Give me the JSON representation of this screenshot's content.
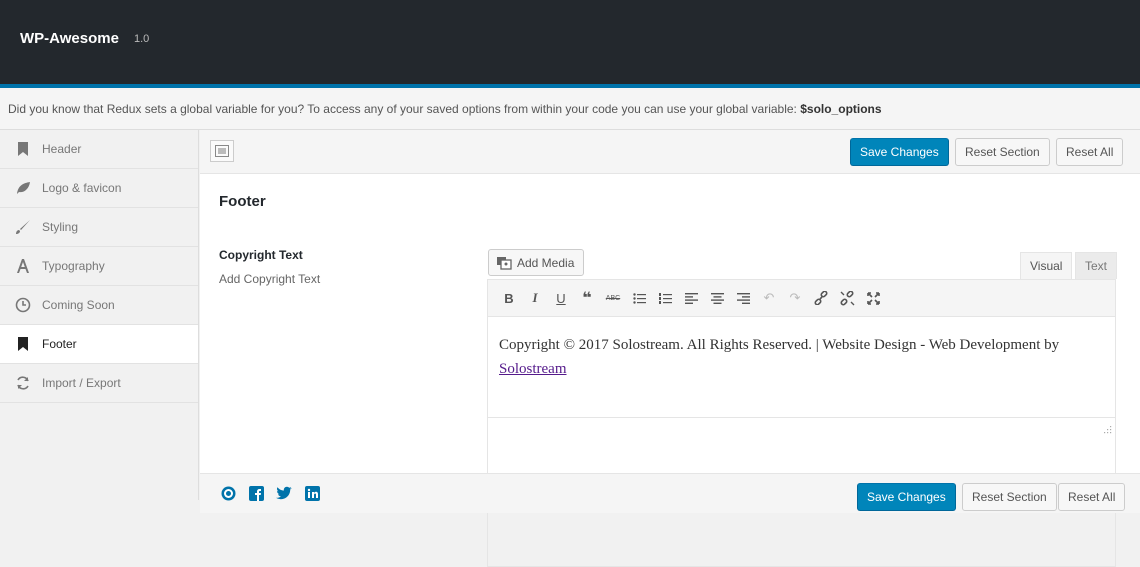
{
  "app": {
    "title": "WP-Awesome",
    "version": "1.0"
  },
  "notice": {
    "text": "Did you know that Redux sets a global variable for you? To access any of your saved options from within your code you can use your global variable: ",
    "variable": "$solo_options"
  },
  "sidebar": {
    "items": [
      {
        "label": "Header",
        "icon": "bookmark-icon"
      },
      {
        "label": "Logo & favicon",
        "icon": "leaf-icon"
      },
      {
        "label": "Styling",
        "icon": "brush-icon"
      },
      {
        "label": "Typography",
        "icon": "font-icon"
      },
      {
        "label": "Coming Soon",
        "icon": "clock-icon"
      },
      {
        "label": "Footer",
        "icon": "bookmark-icon",
        "active": true
      },
      {
        "label": "Import / Export",
        "icon": "refresh-icon"
      }
    ]
  },
  "actions": {
    "save": "Save Changes",
    "reset_section": "Reset Section",
    "reset_all": "Reset All"
  },
  "section": {
    "title": "Footer"
  },
  "field": {
    "label": "Copyright Text",
    "description": "Add Copyright Text"
  },
  "editor": {
    "add_media": "Add Media",
    "tab_visual": "Visual",
    "tab_text": "Text",
    "content_text": "Copyright © 2017 Solostream. All Rights Reserved. | Website Design - Web Development by ",
    "content_link": "Solostream"
  },
  "social": [
    "wordpress-icon",
    "facebook-icon",
    "twitter-icon",
    "linkedin-icon"
  ],
  "colors": {
    "primary": "#0085ba",
    "topbar": "#23282d",
    "accent_line": "#0073aa"
  }
}
